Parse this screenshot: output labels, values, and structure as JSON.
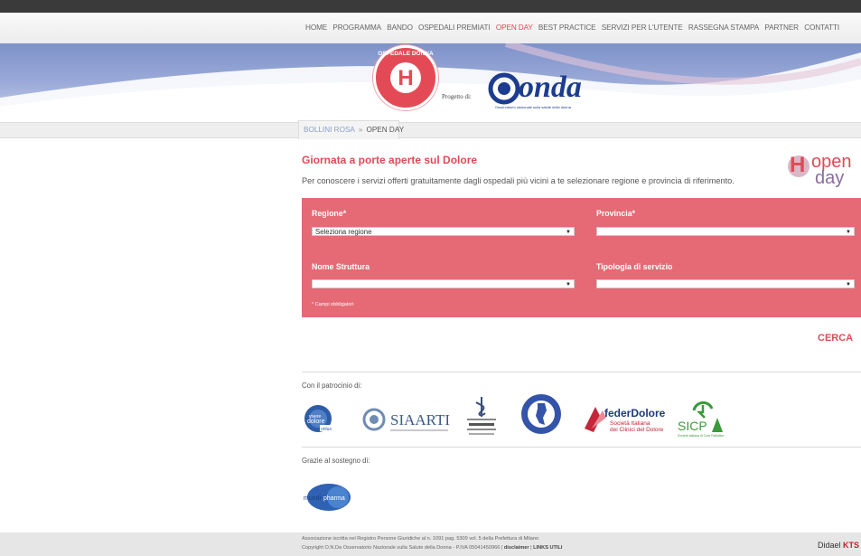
{
  "nav": {
    "items": [
      "HOME",
      "PROGRAMMA",
      "BANDO",
      "OSPEDALI PREMIATI",
      "OPEN DAY",
      "BEST PRACTICE",
      "SERVIZI PER L'UTENTE",
      "RASSEGNA STAMPA",
      "PARTNER",
      "CONTATTI"
    ],
    "active": "OPEN DAY"
  },
  "banner": {
    "logo_arc": "OSPEDALE DONNA",
    "logo_letter": "H",
    "progetto": "Progetto di:",
    "onda_word": "onda",
    "onda_sub": "Osservatorio nazionale sulla salute della donna"
  },
  "breadcrumb": {
    "root": "BOLLINI ROSA",
    "sep": "»",
    "current": "OPEN DAY"
  },
  "page": {
    "title": "Giornata a porte aperte sul Dolore",
    "intro": "Per conoscere i servizi offerti gratuitamente dagli ospedali più vicini a te selezionare regione e provincia di riferimento.",
    "badge_h": "H",
    "badge_open": "open",
    "badge_day": "day"
  },
  "form": {
    "regione_label": "Regione*",
    "regione_value": "Seleziona regione",
    "provincia_label": "Provincia*",
    "provincia_value": "",
    "struttura_label": "Nome Struttura",
    "struttura_value": "",
    "tipologia_label": "Tipologia di servizio",
    "tipologia_value": "",
    "required_note": "* Campi obbligatori",
    "submit": "CERCA"
  },
  "patrocinio": {
    "label": "Con il patrocinio di:",
    "logos": [
      "vivere senza dolore onlus",
      "SIAARTI",
      "Fondazione Paolo Procacci",
      "Associazione",
      "federDolore Società Italiana dei Clinici del Dolore",
      "SICP"
    ]
  },
  "sostegno": {
    "label": "Grazie al sostegno di:",
    "logos": [
      "mundipharma"
    ]
  },
  "footer": {
    "line1": "Associazione iscritta nel Registro Persone Giuridiche al n. 1091 pag. 5309 vol. 5 della Prefettura di Milano",
    "line2": "Copyright O.N.Da Osservatorio Nazionale sulla Salute della Donna - P.IVA 05041450966 |",
    "disclaimer": "disclaimer",
    "links": "LINKS UTILI",
    "brand_a": "Didael",
    "brand_b": "KTS"
  },
  "colors": {
    "accent": "#e04a57",
    "form_bg": "#e56a75",
    "onda_blue": "#1c3c8f"
  }
}
